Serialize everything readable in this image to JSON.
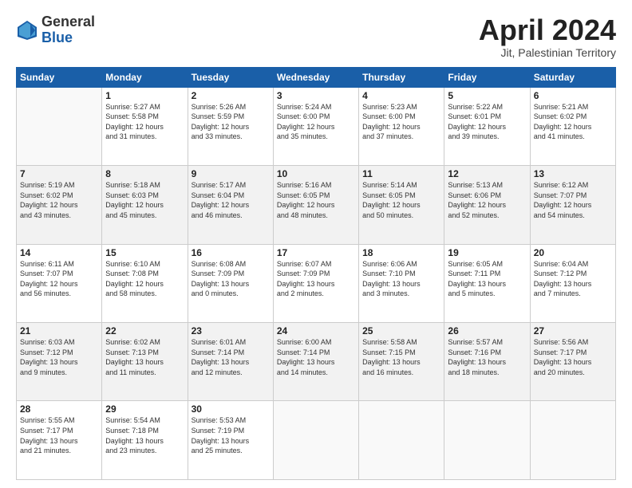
{
  "header": {
    "logo_general": "General",
    "logo_blue": "Blue",
    "month_title": "April 2024",
    "location": "Jit, Palestinian Territory"
  },
  "days_of_week": [
    "Sunday",
    "Monday",
    "Tuesday",
    "Wednesday",
    "Thursday",
    "Friday",
    "Saturday"
  ],
  "weeks": [
    [
      {
        "day": "",
        "info": ""
      },
      {
        "day": "1",
        "info": "Sunrise: 5:27 AM\nSunset: 5:58 PM\nDaylight: 12 hours\nand 31 minutes."
      },
      {
        "day": "2",
        "info": "Sunrise: 5:26 AM\nSunset: 5:59 PM\nDaylight: 12 hours\nand 33 minutes."
      },
      {
        "day": "3",
        "info": "Sunrise: 5:24 AM\nSunset: 6:00 PM\nDaylight: 12 hours\nand 35 minutes."
      },
      {
        "day": "4",
        "info": "Sunrise: 5:23 AM\nSunset: 6:00 PM\nDaylight: 12 hours\nand 37 minutes."
      },
      {
        "day": "5",
        "info": "Sunrise: 5:22 AM\nSunset: 6:01 PM\nDaylight: 12 hours\nand 39 minutes."
      },
      {
        "day": "6",
        "info": "Sunrise: 5:21 AM\nSunset: 6:02 PM\nDaylight: 12 hours\nand 41 minutes."
      }
    ],
    [
      {
        "day": "7",
        "info": "Sunrise: 5:19 AM\nSunset: 6:02 PM\nDaylight: 12 hours\nand 43 minutes."
      },
      {
        "day": "8",
        "info": "Sunrise: 5:18 AM\nSunset: 6:03 PM\nDaylight: 12 hours\nand 45 minutes."
      },
      {
        "day": "9",
        "info": "Sunrise: 5:17 AM\nSunset: 6:04 PM\nDaylight: 12 hours\nand 46 minutes."
      },
      {
        "day": "10",
        "info": "Sunrise: 5:16 AM\nSunset: 6:05 PM\nDaylight: 12 hours\nand 48 minutes."
      },
      {
        "day": "11",
        "info": "Sunrise: 5:14 AM\nSunset: 6:05 PM\nDaylight: 12 hours\nand 50 minutes."
      },
      {
        "day": "12",
        "info": "Sunrise: 5:13 AM\nSunset: 6:06 PM\nDaylight: 12 hours\nand 52 minutes."
      },
      {
        "day": "13",
        "info": "Sunrise: 6:12 AM\nSunset: 7:07 PM\nDaylight: 12 hours\nand 54 minutes."
      }
    ],
    [
      {
        "day": "14",
        "info": "Sunrise: 6:11 AM\nSunset: 7:07 PM\nDaylight: 12 hours\nand 56 minutes."
      },
      {
        "day": "15",
        "info": "Sunrise: 6:10 AM\nSunset: 7:08 PM\nDaylight: 12 hours\nand 58 minutes."
      },
      {
        "day": "16",
        "info": "Sunrise: 6:08 AM\nSunset: 7:09 PM\nDaylight: 13 hours\nand 0 minutes."
      },
      {
        "day": "17",
        "info": "Sunrise: 6:07 AM\nSunset: 7:09 PM\nDaylight: 13 hours\nand 2 minutes."
      },
      {
        "day": "18",
        "info": "Sunrise: 6:06 AM\nSunset: 7:10 PM\nDaylight: 13 hours\nand 3 minutes."
      },
      {
        "day": "19",
        "info": "Sunrise: 6:05 AM\nSunset: 7:11 PM\nDaylight: 13 hours\nand 5 minutes."
      },
      {
        "day": "20",
        "info": "Sunrise: 6:04 AM\nSunset: 7:12 PM\nDaylight: 13 hours\nand 7 minutes."
      }
    ],
    [
      {
        "day": "21",
        "info": "Sunrise: 6:03 AM\nSunset: 7:12 PM\nDaylight: 13 hours\nand 9 minutes."
      },
      {
        "day": "22",
        "info": "Sunrise: 6:02 AM\nSunset: 7:13 PM\nDaylight: 13 hours\nand 11 minutes."
      },
      {
        "day": "23",
        "info": "Sunrise: 6:01 AM\nSunset: 7:14 PM\nDaylight: 13 hours\nand 12 minutes."
      },
      {
        "day": "24",
        "info": "Sunrise: 6:00 AM\nSunset: 7:14 PM\nDaylight: 13 hours\nand 14 minutes."
      },
      {
        "day": "25",
        "info": "Sunrise: 5:58 AM\nSunset: 7:15 PM\nDaylight: 13 hours\nand 16 minutes."
      },
      {
        "day": "26",
        "info": "Sunrise: 5:57 AM\nSunset: 7:16 PM\nDaylight: 13 hours\nand 18 minutes."
      },
      {
        "day": "27",
        "info": "Sunrise: 5:56 AM\nSunset: 7:17 PM\nDaylight: 13 hours\nand 20 minutes."
      }
    ],
    [
      {
        "day": "28",
        "info": "Sunrise: 5:55 AM\nSunset: 7:17 PM\nDaylight: 13 hours\nand 21 minutes."
      },
      {
        "day": "29",
        "info": "Sunrise: 5:54 AM\nSunset: 7:18 PM\nDaylight: 13 hours\nand 23 minutes."
      },
      {
        "day": "30",
        "info": "Sunrise: 5:53 AM\nSunset: 7:19 PM\nDaylight: 13 hours\nand 25 minutes."
      },
      {
        "day": "",
        "info": ""
      },
      {
        "day": "",
        "info": ""
      },
      {
        "day": "",
        "info": ""
      },
      {
        "day": "",
        "info": ""
      }
    ]
  ]
}
